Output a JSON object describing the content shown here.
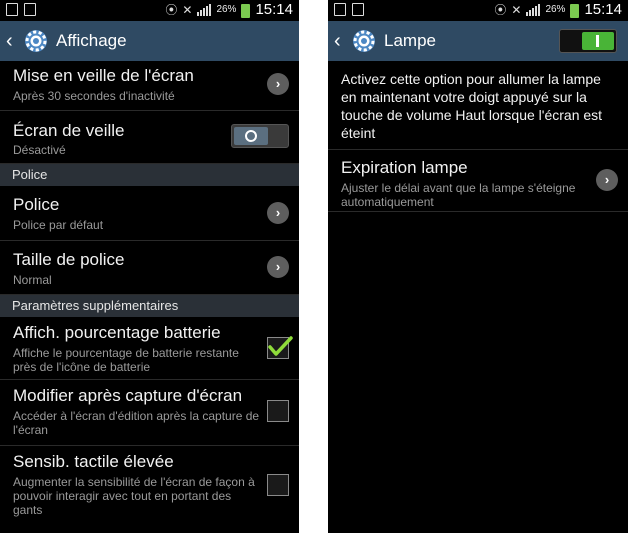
{
  "status_bar": {
    "battery_percent": "26%",
    "time": "15:14"
  },
  "left": {
    "title": "Affichage",
    "items": [
      {
        "title": "Mise en veille de l'écran",
        "subtitle": "Après 30 secondes d'inactivité"
      },
      {
        "title": "Écran de veille",
        "subtitle": "Désactivé"
      }
    ],
    "sections": [
      "Police",
      "Paramètres supplémentaires"
    ],
    "police_items": [
      {
        "title": "Police",
        "subtitle": "Police par défaut"
      },
      {
        "title": "Taille de police",
        "subtitle": "Normal"
      }
    ],
    "extra_items": [
      {
        "title": "Affich. pourcentage batterie",
        "subtitle": "Affiche le pourcentage de batterie restante près de l'icône de batterie",
        "checked": true
      },
      {
        "title": "Modifier après capture d'écran",
        "subtitle": "Accéder à l'écran d'édition après la capture de l'écran",
        "checked": false
      },
      {
        "title": "Sensib. tactile élevée",
        "subtitle": "Augmenter la sensibilité de l'écran de façon à pouvoir interagir avec tout en portant des gants",
        "checked": false
      }
    ]
  },
  "right": {
    "title": "Lampe",
    "toggle_on": true,
    "description": "Activez cette option pour allumer la lampe en maintenant votre doigt appuyé sur la touche de volume Haut lorsque l'écran est éteint",
    "item": {
      "title": "Expiration lampe",
      "subtitle": "Ajuster le délai avant que la lampe s'éteigne automatiquement"
    }
  },
  "colors": {
    "action_bar": "#2f4a63",
    "section_header": "#2a3037",
    "accent_green": "#49b437",
    "check_green": "#8fdc3a"
  },
  "icons": [
    "picture-icon",
    "sim-card-icon",
    "vibrate-icon",
    "mute-icon",
    "signal-icon",
    "battery-charging-icon",
    "back-arrow-icon",
    "gear-icon",
    "chevron-right-icon",
    "check-icon"
  ]
}
